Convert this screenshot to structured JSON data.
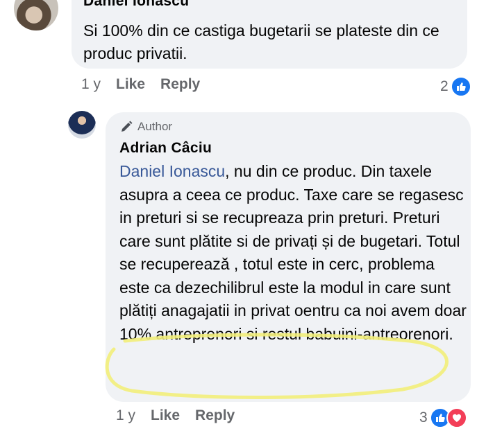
{
  "comments": [
    {
      "author": "Daniel Ionascu",
      "text": "Si 100% din ce castiga bugetarii se plateste din ce produc privatii.",
      "time": "1 y",
      "like_label": "Like",
      "reply_label": "Reply",
      "reaction_count": "2"
    },
    {
      "badge": "Author",
      "author": "Adrian Câciu",
      "mention": "Daniel Ionascu",
      "text": ", nu din ce produc. Din taxele asupra a ceea ce produc. Taxe care se regasesc in preturi si se recupreaza prin preturi. Preturi care sunt plătite si de privați și de bugetari. Totul se recuperează , totul este in cerc, problema este ca dezechilibrul este la modul in care sunt plătiți anagajatii in privat oentru ca noi avem doar 10% antreprenori si restul babuini-antreorenori.",
      "time": "1 y",
      "like_label": "Like",
      "reply_label": "Reply",
      "reaction_count": "3"
    }
  ],
  "colors": {
    "bubble": "#f0f2f5",
    "secondary_text": "#65676b",
    "mention": "#385898",
    "like_blue": "#1877f2",
    "love_red": "#f33e58",
    "highlight": "#f2ee7a"
  },
  "icons": [
    "thumbs-up-icon",
    "heart-icon",
    "pencil-icon"
  ]
}
